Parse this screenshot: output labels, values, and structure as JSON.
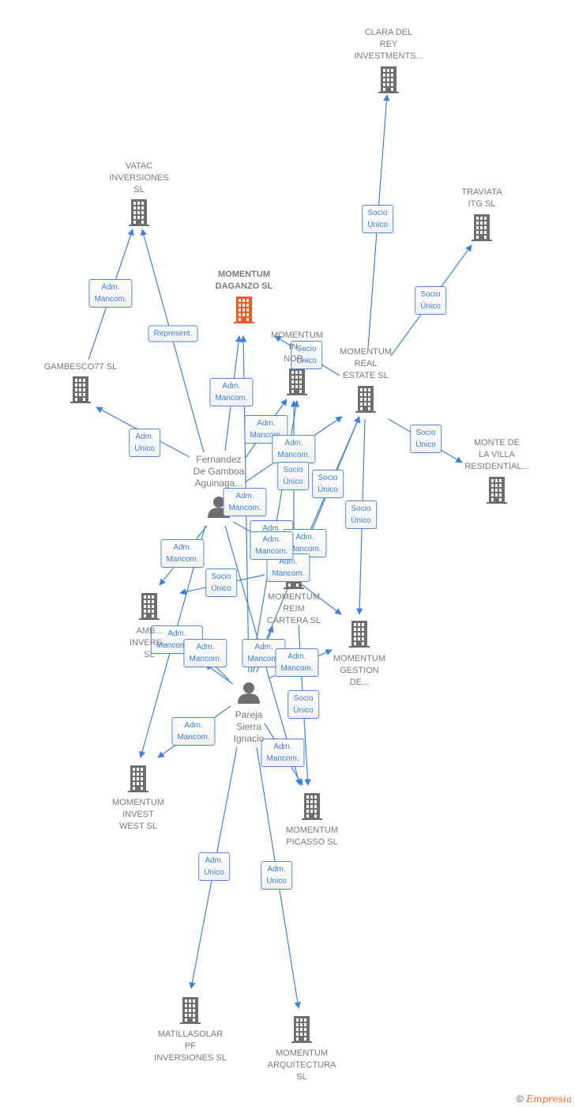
{
  "colors": {
    "edge": "#3c82dc",
    "building": "#6e6e6e",
    "focus_building": "#f05a23",
    "label": "#7a7a7a"
  },
  "nodes": [
    {
      "id": "clara",
      "type": "company",
      "lines": [
        "CLARA DEL",
        "REY",
        "INVESTMENTS..."
      ]
    },
    {
      "id": "traviata",
      "type": "company",
      "lines": [
        "TRAVIATA",
        "ITG  SL"
      ]
    },
    {
      "id": "vatac",
      "type": "company",
      "lines": [
        "VATAC",
        "INVERSIONES",
        "SL"
      ]
    },
    {
      "id": "daganzo",
      "type": "company-focus",
      "lines": [
        "MOMENTUM",
        "DAGANZO  SL"
      ]
    },
    {
      "id": "nor",
      "type": "company",
      "lines": [
        "MOMENTUM",
        "IN...",
        "NOR..."
      ]
    },
    {
      "id": "realestate",
      "type": "company",
      "lines": [
        "MOMENTUM",
        "REAL",
        "ESTATE SL"
      ]
    },
    {
      "id": "gambesco",
      "type": "company",
      "lines": [
        "GAMBESCO77 SL"
      ]
    },
    {
      "id": "monte",
      "type": "company",
      "lines": [
        "MONTE DE",
        "LA VILLA",
        "RESIDENTIAL..."
      ]
    },
    {
      "id": "fernandez",
      "type": "person",
      "lines": [
        "Fernandez",
        "De Gamboa",
        "Aguinaga..."
      ]
    },
    {
      "id": "amb",
      "type": "company",
      "lines": [
        "AMB...",
        "INVERS...",
        "SL"
      ]
    },
    {
      "id": "reim",
      "type": "company",
      "lines": [
        "MOMENTUM",
        "REIM",
        "CARTERA  SL"
      ]
    },
    {
      "id": "gestion",
      "type": "company",
      "lines": [
        "MOMENTUM",
        "GESTION",
        "DE..."
      ]
    },
    {
      "id": "pareja",
      "type": "person",
      "lines": [
        "Pareja",
        "Sierra",
        "Ignacio"
      ]
    },
    {
      "id": "west",
      "type": "company",
      "lines": [
        "MOMENTUM",
        "INVEST",
        "WEST  SL"
      ]
    },
    {
      "id": "picasso",
      "type": "company",
      "lines": [
        "MOMENTUM",
        "PICASSO  SL"
      ]
    },
    {
      "id": "matilla",
      "type": "company",
      "lines": [
        "MATILLASOLAR",
        "PF",
        "INVERSIONES SL"
      ]
    },
    {
      "id": "arquitectura",
      "type": "company",
      "lines": [
        "MOMENTUM",
        "ARQUITECTURA",
        "SL"
      ]
    }
  ],
  "edges": [
    {
      "from": "realestate",
      "to": "clara",
      "label": "Socio\nÚnico"
    },
    {
      "from": "realestate",
      "to": "traviata",
      "label": "Socio\nÚnico"
    },
    {
      "from": "gambesco",
      "to": "vatac",
      "label": "Adm.\nMancom."
    },
    {
      "from": "fernandez",
      "to": "vatac",
      "label": "Represent."
    },
    {
      "from": "fernandez",
      "to": "gambesco",
      "label": "Adm.\nUnico"
    },
    {
      "from": "fernandez",
      "to": "daganzo",
      "label": "Adm.\nMancom."
    },
    {
      "from": "fernandez",
      "to": "nor",
      "label": "Adm.\nMancom."
    },
    {
      "from": "fernandez",
      "to": "realestate",
      "label": "Adm.\nMancom."
    },
    {
      "from": "realestate",
      "to": "nor",
      "label": "Socio\nÚnico"
    },
    {
      "from": "reim",
      "to": "nor",
      "label": "Socio\nÚnico"
    },
    {
      "from": "reim",
      "to": "realestate",
      "label": "Socio\nÚnico"
    },
    {
      "from": "realestate",
      "to": "gestion",
      "label": "Socio\nÚnico"
    },
    {
      "from": "realestate",
      "to": "monte",
      "label": "Socio\nÚnico"
    },
    {
      "from": "pareja",
      "to": "daganzo",
      "label": "Adm.\nMancom."
    },
    {
      "from": "fernandez",
      "to": "amb",
      "label": "Adm.\nMancom."
    },
    {
      "from": "reim",
      "to": "amb",
      "label": "Socio\nÚnico"
    },
    {
      "from": "fernandez",
      "to": "reim",
      "label": "Adm.\nMancom."
    },
    {
      "from": "pareja",
      "to": "nor",
      "label": "Adm.\nMancom."
    },
    {
      "from": "fernandez",
      "to": "gestion",
      "label": "Adm.\nMancom."
    },
    {
      "from": "pareja",
      "to": "realestate",
      "label": "Adm.\nMancom."
    },
    {
      "from": "pareja",
      "to": "amb",
      "label": "Adm.\nMancom.,..."
    },
    {
      "from": "pareja",
      "to": "west",
      "label": "Adm.\nMancom."
    },
    {
      "from": "pareja",
      "to": "reim",
      "label": "Adm.\nMancom."
    },
    {
      "from": "pareja",
      "to": "gestion",
      "label": "Adm.\nMancom."
    },
    {
      "from": "reim",
      "to": "picasso",
      "label": "Socio\nÚnico"
    },
    {
      "from": "pareja",
      "to": "west",
      "label": "Adm.\nMancom."
    },
    {
      "from": "pareja",
      "to": "picasso",
      "label": "Adm.\nMancom."
    },
    {
      "from": "pareja",
      "to": "matilla",
      "label": "Adm.\nUnico"
    },
    {
      "from": "pareja",
      "to": "arquitectura",
      "label": "Adm.\nUnico"
    },
    {
      "from": "fernandez",
      "to": "west",
      "label": ""
    },
    {
      "from": "fernandez",
      "to": "picasso",
      "label": ""
    }
  ],
  "footer": {
    "copyright": "©",
    "brand": "Empresia"
  }
}
